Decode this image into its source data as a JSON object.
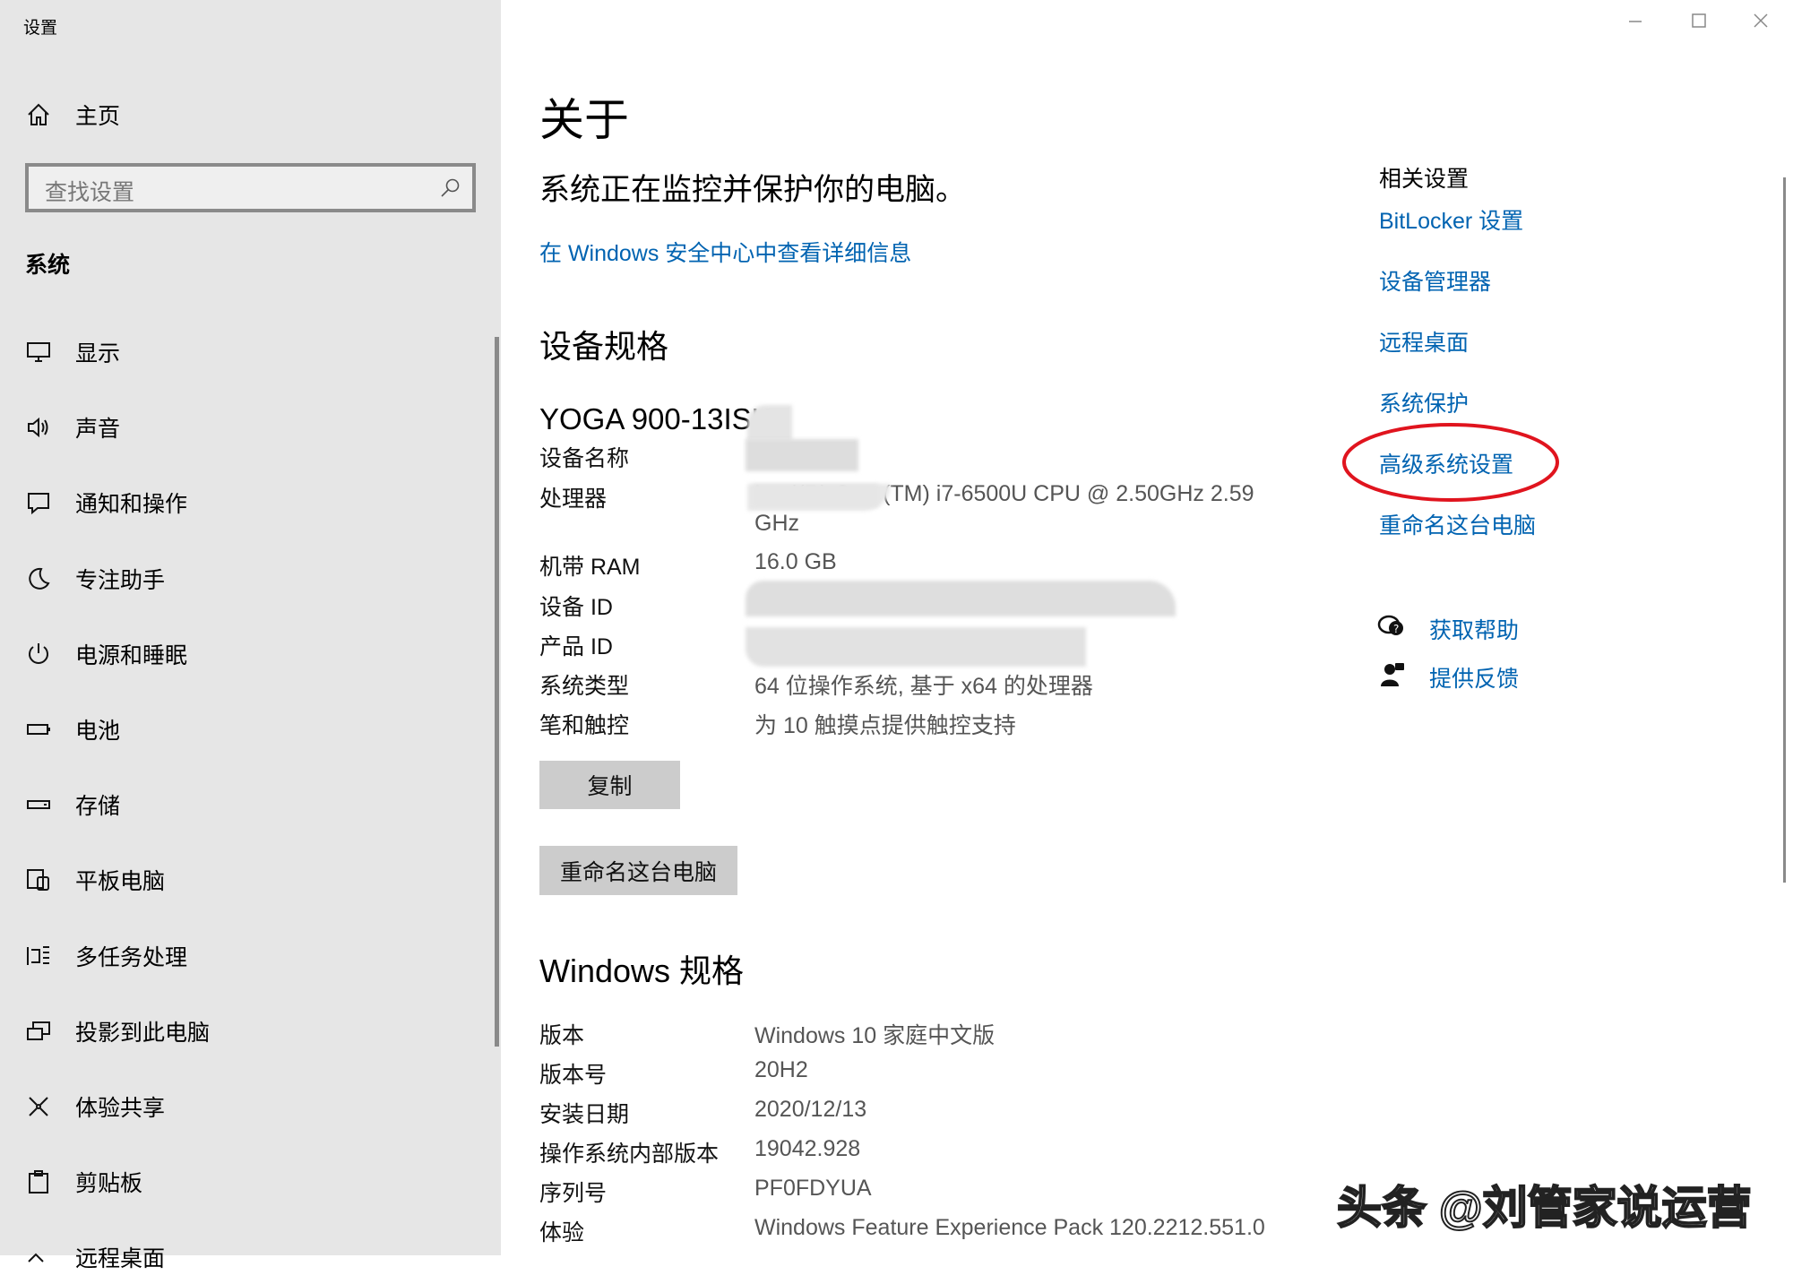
{
  "window": {
    "title": "设置"
  },
  "sidebar": {
    "home": "主页",
    "search_placeholder": "查找设置",
    "section": "系统",
    "items": [
      {
        "label": "显示",
        "icon": "monitor-icon"
      },
      {
        "label": "声音",
        "icon": "speaker-icon"
      },
      {
        "label": "通知和操作",
        "icon": "notification-icon"
      },
      {
        "label": "专注助手",
        "icon": "moon-icon"
      },
      {
        "label": "电源和睡眠",
        "icon": "power-icon"
      },
      {
        "label": "电池",
        "icon": "battery-icon"
      },
      {
        "label": "存储",
        "icon": "storage-icon"
      },
      {
        "label": "平板电脑",
        "icon": "tablet-icon"
      },
      {
        "label": "多任务处理",
        "icon": "multitask-icon"
      },
      {
        "label": "投影到此电脑",
        "icon": "project-icon"
      },
      {
        "label": "体验共享",
        "icon": "share-icon"
      },
      {
        "label": "剪贴板",
        "icon": "clipboard-icon"
      },
      {
        "label": "远程桌面",
        "icon": "remote-desktop-icon"
      }
    ]
  },
  "main": {
    "title": "关于",
    "protect_text": "系统正在监控并保护你的电脑。",
    "security_link": "在 Windows 安全中心中查看详细信息",
    "device_spec_heading": "设备规格",
    "device_model": "YOGA 900-13ISK",
    "device_specs": [
      {
        "label": "设备名称",
        "value": ""
      },
      {
        "label": "处理器",
        "value": "Intel(R) Core(TM) i7-6500U CPU @ 2.50GHz   2.59",
        "value2": "GHz"
      },
      {
        "label": "机带 RAM",
        "value": "16.0 GB"
      },
      {
        "label": "设备 ID",
        "value": ""
      },
      {
        "label": "产品 ID",
        "value": ""
      },
      {
        "label": "系统类型",
        "value": "64 位操作系统, 基于 x64 的处理器"
      },
      {
        "label": "笔和触控",
        "value": "为 10 触摸点提供触控支持"
      }
    ],
    "copy_button": "复制",
    "rename_button": "重命名这台电脑",
    "windows_spec_heading": "Windows 规格",
    "windows_specs": [
      {
        "label": "版本",
        "value": "Windows 10 家庭中文版"
      },
      {
        "label": "版本号",
        "value": "20H2"
      },
      {
        "label": "安装日期",
        "value": "2020/12/13"
      },
      {
        "label": "操作系统内部版本",
        "value": "19042.928"
      },
      {
        "label": "序列号",
        "value": "PF0FDYUA"
      },
      {
        "label": "体验",
        "value": "Windows Feature Experience Pack 120.2212.551.0"
      }
    ]
  },
  "related": {
    "heading": "相关设置",
    "links": [
      "BitLocker 设置",
      "设备管理器",
      "远程桌面",
      "系统保护",
      "高级系统设置",
      "重命名这台电脑"
    ],
    "help": "获取帮助",
    "feedback": "提供反馈"
  },
  "watermark": "头条 @刘管家说运营",
  "colors": {
    "link": "#0063b1",
    "sidebar": "#e6e6e6",
    "annotation": "#e0141e"
  }
}
